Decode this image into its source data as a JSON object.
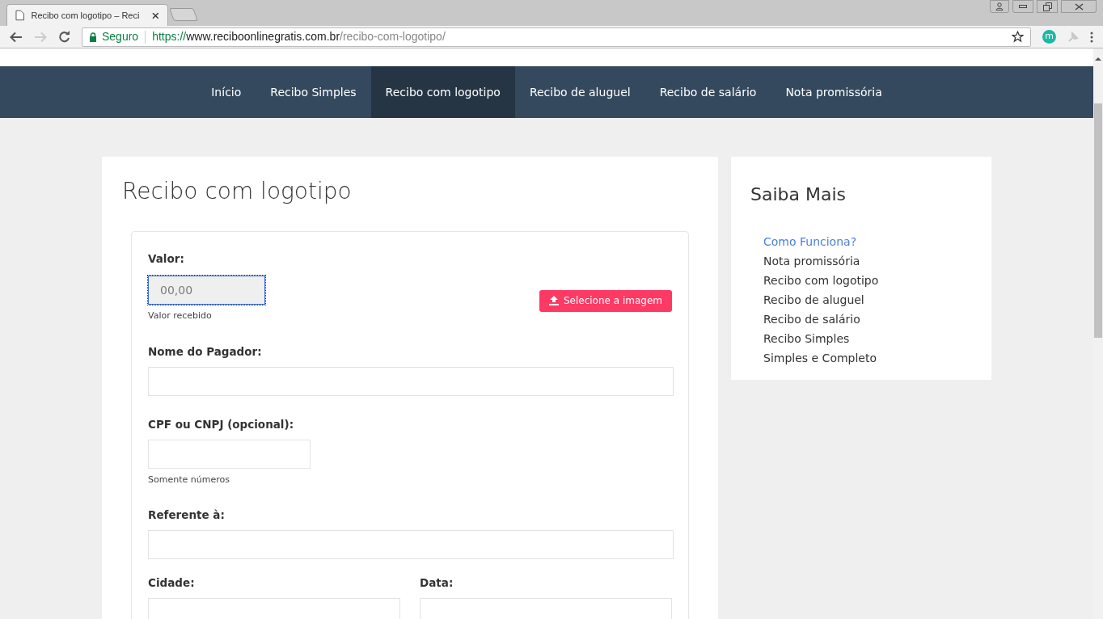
{
  "browser": {
    "tab_title": "Recibo com logotipo – Reci",
    "security_label": "Seguro",
    "url_scheme": "https://",
    "url_host": "www.reciboonlinegratis.com.br",
    "url_path": "/recibo-com-logotipo/",
    "profile_letter": "m"
  },
  "nav": [
    {
      "label": "Início",
      "selected": false
    },
    {
      "label": "Recibo Simples",
      "selected": false
    },
    {
      "label": "Recibo com logotipo",
      "selected": true
    },
    {
      "label": "Recibo de aluguel",
      "selected": false
    },
    {
      "label": "Recibo de salário",
      "selected": false
    },
    {
      "label": "Nota promissória",
      "selected": false
    }
  ],
  "main": {
    "title": "Recibo com logotipo",
    "form": {
      "valor": {
        "label": "Valor:",
        "placeholder": "00,00",
        "focused": true,
        "help": "Valor recebido"
      },
      "upload_button": "Selecione a imagem",
      "fields": [
        {
          "label": "Nome do Pagador:",
          "kind": "wide"
        },
        {
          "label": "CPF ou CNPJ (opcional):",
          "kind": "short",
          "help": "Somente números"
        },
        {
          "label": "Referente à:",
          "kind": "wide"
        }
      ],
      "bottom_fields": [
        {
          "label": "Cidade:"
        },
        {
          "label": "Data:"
        }
      ]
    }
  },
  "sidebar": {
    "title": "Saiba Mais",
    "links": [
      {
        "label": "Como Funciona?",
        "active": true
      },
      {
        "label": "Nota promissória",
        "active": false
      },
      {
        "label": "Recibo com logotipo",
        "active": false
      },
      {
        "label": "Recibo de aluguel",
        "active": false
      },
      {
        "label": "Recibo de salário",
        "active": false
      },
      {
        "label": "Recibo Simples",
        "active": false
      },
      {
        "label": "Simples e Completo",
        "active": false
      }
    ]
  }
}
